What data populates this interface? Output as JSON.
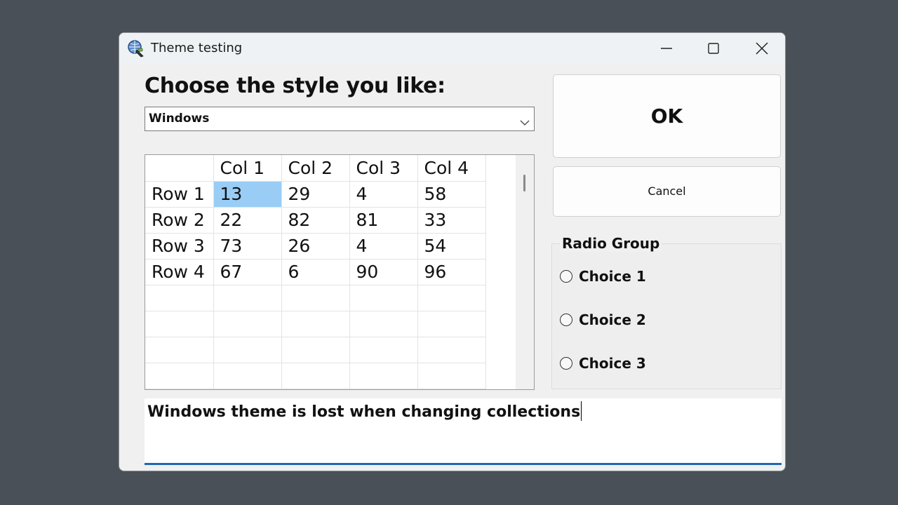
{
  "window": {
    "title": "Theme testing",
    "icon": "globe-app-icon",
    "controls": {
      "minimize": "minimize-icon",
      "maximize": "maximize-icon",
      "close": "close-icon"
    }
  },
  "heading": "Choose the style you like:",
  "style_select": {
    "value": "Windows",
    "icon": "chevron-down-icon"
  },
  "grid": {
    "columns": [
      "",
      "Col 1",
      "Col 2",
      "Col 3",
      "Col 4"
    ],
    "rows": [
      {
        "header": "Row 1",
        "cells": [
          "13",
          "29",
          "4",
          "58"
        ]
      },
      {
        "header": "Row 2",
        "cells": [
          "22",
          "82",
          "81",
          "33"
        ]
      },
      {
        "header": "Row 3",
        "cells": [
          "73",
          "26",
          "4",
          "54"
        ]
      },
      {
        "header": "Row 4",
        "cells": [
          "67",
          "6",
          "90",
          "96"
        ]
      },
      {
        "header": "",
        "cells": [
          "",
          "",
          "",
          ""
        ]
      },
      {
        "header": "",
        "cells": [
          "",
          "",
          "",
          ""
        ]
      },
      {
        "header": "",
        "cells": [
          "",
          "",
          "",
          ""
        ]
      },
      {
        "header": "",
        "cells": [
          "",
          "",
          "",
          ""
        ]
      }
    ],
    "selected_cell": {
      "row": 0,
      "col": 0
    },
    "selection_color": "#99cdf6"
  },
  "buttons": {
    "ok": "OK",
    "cancel": "Cancel"
  },
  "radio_group": {
    "title": "Radio Group",
    "choices": [
      "Choice 1",
      "Choice 2",
      "Choice 3"
    ],
    "selected": null
  },
  "text_box": {
    "value": "Windows theme is lost when changing collections",
    "accent_color": "#1f67b1"
  },
  "colors": {
    "desktop": "#4a5057",
    "window_bg": "#f0f0f0"
  }
}
